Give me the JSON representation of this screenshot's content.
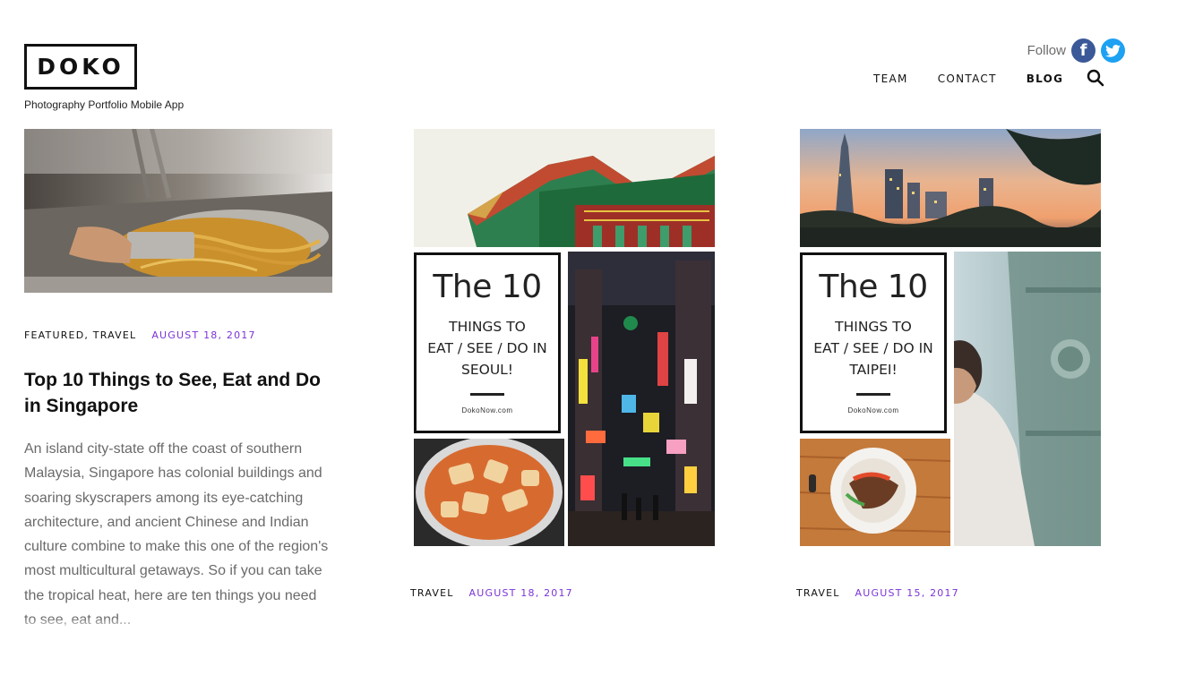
{
  "brand": {
    "logo": "DOKO",
    "tagline": "Photography Portfolio Mobile App"
  },
  "social": {
    "follow_label": "Follow",
    "facebook_glyph": "f",
    "facebook_icon": "facebook-icon",
    "twitter_icon": "twitter-icon"
  },
  "nav": {
    "items": [
      {
        "label": "TEAM"
      },
      {
        "label": "CONTACT"
      },
      {
        "label": "BLOG"
      }
    ],
    "search_icon": "search-icon"
  },
  "colors": {
    "accent": "#7b33d6",
    "facebook": "#3b5998",
    "twitter": "#1da1f2"
  },
  "posts": [
    {
      "categories": "FEATURED, TRAVEL",
      "date": "AUGUST 18, 2017",
      "title": "Top 10 Things to See, Eat and Do in Singapore",
      "excerpt": "An island city-state off the coast of southern Malaysia, Singapore has colonial buildings and soaring skyscrapers among its eye-catching architecture, and ancient Chinese and Indian culture combine to make this one of the region's most multicultural getaways. So if you can take the tropical heat, here are ten things you need to see, eat and..."
    },
    {
      "categories": "TRAVEL",
      "date": "AUGUST 18, 2017",
      "collage": {
        "heading": "The 10",
        "line1": "THINGS TO",
        "line2": "EAT / SEE / DO IN",
        "line3": "SEOUL!",
        "site": "DokoNow.com"
      }
    },
    {
      "categories": "TRAVEL",
      "date": "AUGUST 15, 2017",
      "collage": {
        "heading": "The 10",
        "line1": "THINGS TO",
        "line2": "EAT / SEE / DO IN",
        "line3": "TAIPEI!",
        "site": "DokoNow.com"
      }
    }
  ]
}
